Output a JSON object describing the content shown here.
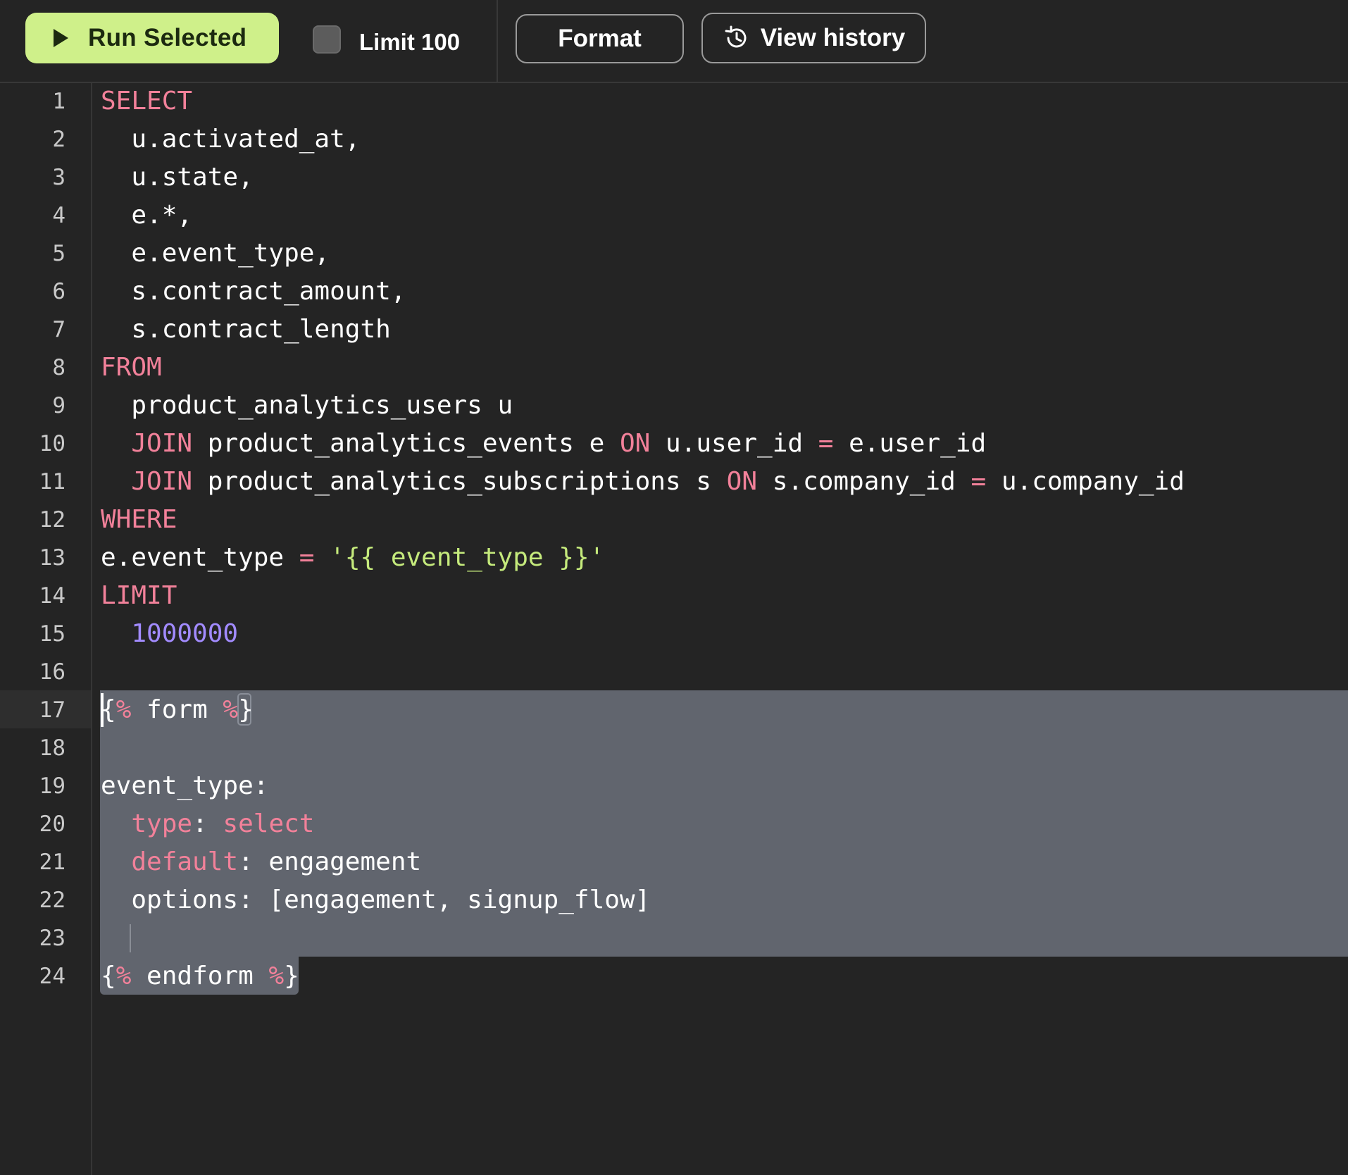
{
  "toolbar": {
    "run_label": "Run Selected",
    "limit_label": "Limit 100",
    "limit_checked": false,
    "format_label": "Format",
    "history_label": "View history"
  },
  "icons": {
    "run": "play-icon",
    "history": "history-clock-icon"
  },
  "colors": {
    "accent": "#cff08a",
    "keyword": "#f2819a",
    "string": "#c5ea7c",
    "number": "#a28bff",
    "selection": "#61656e",
    "background": "#242424"
  },
  "editor": {
    "active_line": 17,
    "lines": [
      {
        "n": "1",
        "tokens": [
          {
            "t": "SELECT",
            "c": "kw"
          }
        ]
      },
      {
        "n": "2",
        "tokens": [
          {
            "t": "  u.activated_at,",
            "c": "plain"
          }
        ]
      },
      {
        "n": "3",
        "tokens": [
          {
            "t": "  u.state,",
            "c": "plain"
          }
        ]
      },
      {
        "n": "4",
        "tokens": [
          {
            "t": "  e.*,",
            "c": "plain"
          }
        ]
      },
      {
        "n": "5",
        "tokens": [
          {
            "t": "  e.event_type,",
            "c": "plain"
          }
        ]
      },
      {
        "n": "6",
        "tokens": [
          {
            "t": "  s.contract_amount,",
            "c": "plain"
          }
        ]
      },
      {
        "n": "7",
        "tokens": [
          {
            "t": "  s.contract_length",
            "c": "plain"
          }
        ]
      },
      {
        "n": "8",
        "tokens": [
          {
            "t": "FROM",
            "c": "kw"
          }
        ]
      },
      {
        "n": "9",
        "tokens": [
          {
            "t": "  product_analytics_users u",
            "c": "plain"
          }
        ]
      },
      {
        "n": "10",
        "tokens": [
          {
            "t": "  ",
            "c": "plain"
          },
          {
            "t": "JOIN",
            "c": "kw"
          },
          {
            "t": " product_analytics_events e ",
            "c": "plain"
          },
          {
            "t": "ON",
            "c": "kw"
          },
          {
            "t": " u.user_id ",
            "c": "plain"
          },
          {
            "t": "=",
            "c": "op"
          },
          {
            "t": " e.user_id",
            "c": "plain"
          }
        ]
      },
      {
        "n": "11",
        "tokens": [
          {
            "t": "  ",
            "c": "plain"
          },
          {
            "t": "JOIN",
            "c": "kw"
          },
          {
            "t": " product_analytics_subscriptions s ",
            "c": "plain"
          },
          {
            "t": "ON",
            "c": "kw"
          },
          {
            "t": " s.company_id ",
            "c": "plain"
          },
          {
            "t": "=",
            "c": "op"
          },
          {
            "t": " u.company_id",
            "c": "plain"
          }
        ]
      },
      {
        "n": "12",
        "tokens": [
          {
            "t": "WHERE",
            "c": "kw"
          }
        ]
      },
      {
        "n": "13",
        "tokens": [
          {
            "t": "e.event_type ",
            "c": "plain"
          },
          {
            "t": "=",
            "c": "op"
          },
          {
            "t": " ",
            "c": "plain"
          },
          {
            "t": "'{{ event_type }}'",
            "c": "str"
          }
        ]
      },
      {
        "n": "14",
        "tokens": [
          {
            "t": "LIMIT",
            "c": "kw"
          }
        ]
      },
      {
        "n": "15",
        "tokens": [
          {
            "t": "  ",
            "c": "plain"
          },
          {
            "t": "1000000",
            "c": "num"
          }
        ]
      },
      {
        "n": "16",
        "tokens": []
      },
      {
        "n": "17",
        "tokens": [
          {
            "t": "{",
            "c": "plain"
          },
          {
            "t": "%",
            "c": "tpl"
          },
          {
            "t": " form ",
            "c": "plain"
          },
          {
            "t": "%",
            "c": "tpl"
          },
          {
            "t": "}",
            "c": "plain"
          }
        ]
      },
      {
        "n": "18",
        "tokens": []
      },
      {
        "n": "19",
        "tokens": [
          {
            "t": "event_type:",
            "c": "plain"
          }
        ]
      },
      {
        "n": "20",
        "tokens": [
          {
            "t": "  ",
            "c": "plain"
          },
          {
            "t": "type",
            "c": "kw"
          },
          {
            "t": ": ",
            "c": "plain"
          },
          {
            "t": "select",
            "c": "kw"
          }
        ]
      },
      {
        "n": "21",
        "tokens": [
          {
            "t": "  ",
            "c": "plain"
          },
          {
            "t": "default",
            "c": "kw"
          },
          {
            "t": ": engagement",
            "c": "plain"
          }
        ]
      },
      {
        "n": "22",
        "tokens": [
          {
            "t": "  options: [engagement, signup_flow]",
            "c": "plain"
          }
        ]
      },
      {
        "n": "23",
        "tokens": []
      },
      {
        "n": "24",
        "tokens": [
          {
            "t": "{",
            "c": "plain"
          },
          {
            "t": "%",
            "c": "tpl"
          },
          {
            "t": " endform ",
            "c": "plain"
          },
          {
            "t": "%",
            "c": "tpl"
          },
          {
            "t": "}",
            "c": "plain"
          }
        ]
      }
    ]
  }
}
